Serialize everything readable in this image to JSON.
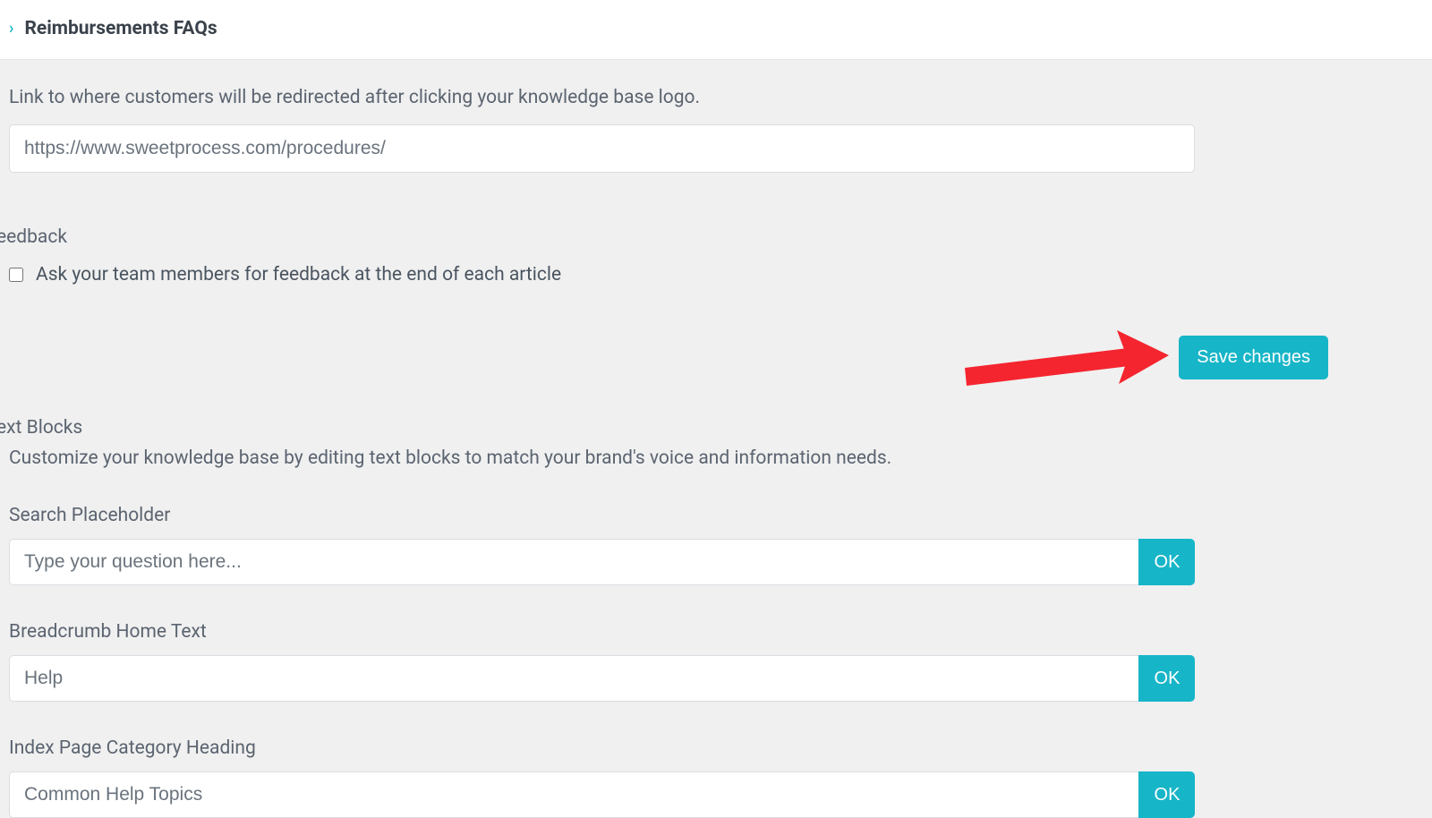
{
  "header": {
    "chevron": "›",
    "title": "Reimbursements FAQs"
  },
  "logo_link": {
    "description": "Link to where customers will be redirected after clicking your knowledge base logo.",
    "value": "https://www.sweetprocess.com/procedures/"
  },
  "feedback": {
    "section_label": "eedback",
    "checkbox_label": "Ask your team members for feedback at the end of each article",
    "checked": false
  },
  "save_button_label": "Save changes",
  "text_blocks": {
    "section_label": "ext Blocks",
    "description": "Customize your knowledge base by editing text blocks to match your brand's voice and information needs.",
    "fields": {
      "search_placeholder": {
        "label": "Search Placeholder",
        "value": "Type your question here...",
        "ok": "OK"
      },
      "breadcrumb_home": {
        "label": "Breadcrumb Home Text",
        "value": "Help",
        "ok": "OK"
      },
      "index_heading": {
        "label": "Index Page Category Heading",
        "value": "Common Help Topics",
        "ok": "OK"
      }
    }
  },
  "annotation": {
    "arrow_color": "#f4252f"
  }
}
